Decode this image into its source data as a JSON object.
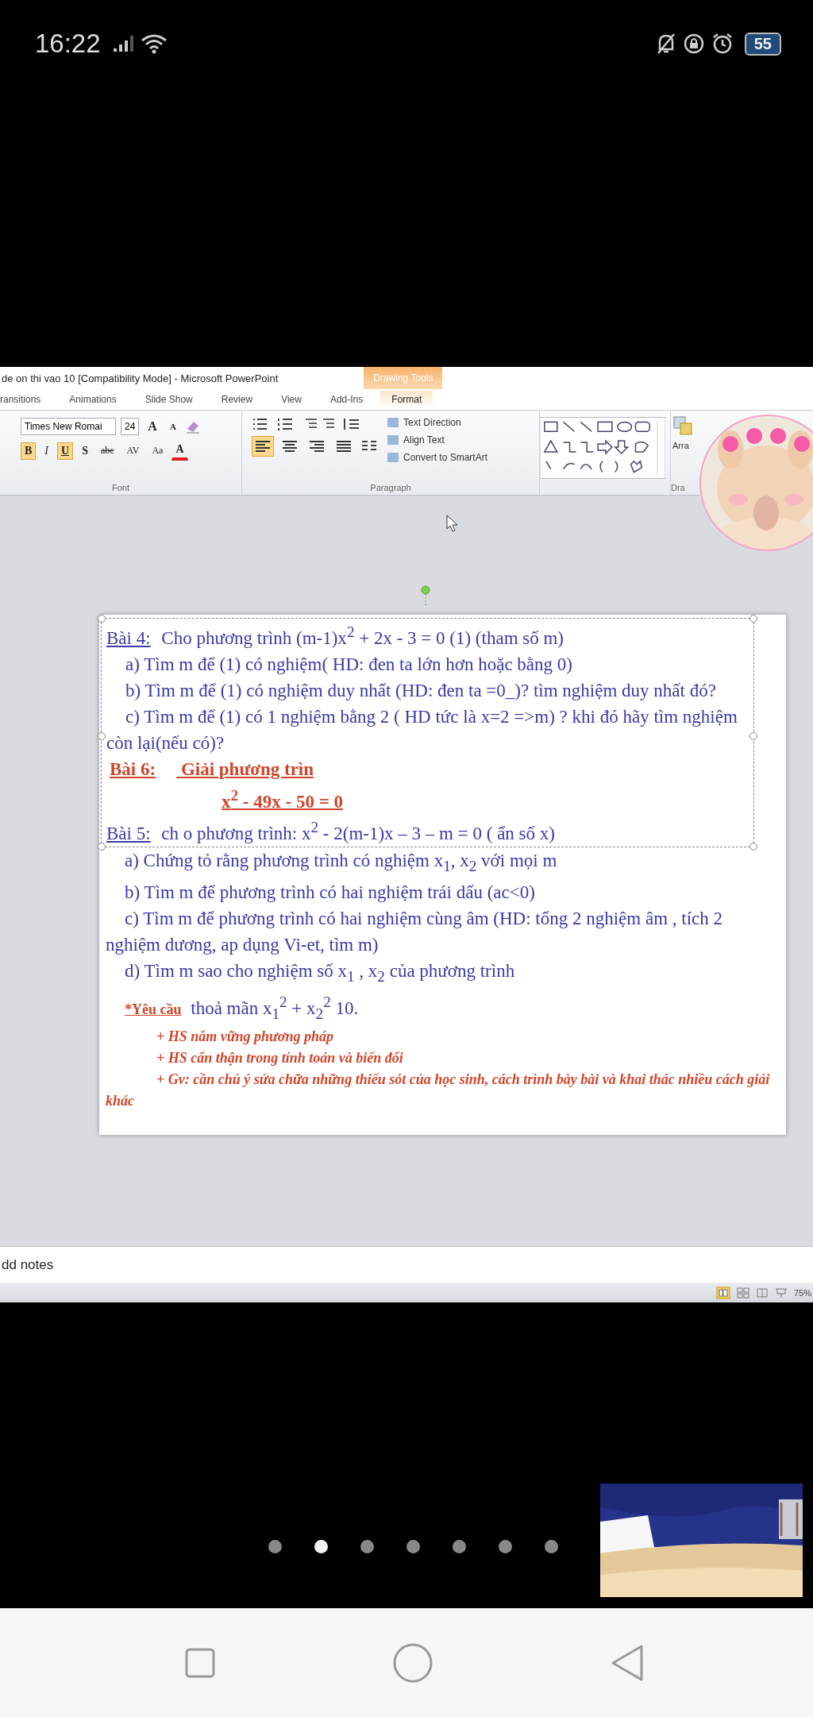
{
  "status_bar": {
    "time": "16:22",
    "battery": "55"
  },
  "powerpoint": {
    "title": "de on thi vao 10 [Compatibility Mode]  -  Microsoft PowerPoint",
    "context_tab_label": "Drawing Tools",
    "tabs": [
      {
        "label": "ransitions",
        "selected": false
      },
      {
        "label": "Animations",
        "selected": false
      },
      {
        "label": "Slide Show",
        "selected": false
      },
      {
        "label": "Review",
        "selected": false
      },
      {
        "label": "View",
        "selected": false
      },
      {
        "label": "Add-Ins",
        "selected": false
      },
      {
        "label": "Format",
        "selected": true
      }
    ],
    "ribbon": {
      "font_name": "Times New Romai",
      "font_size": "24",
      "grow_font": "A",
      "shrink_font": "A",
      "format_buttons": [
        {
          "label": "B",
          "kind": "bold",
          "selected": true
        },
        {
          "label": "I",
          "kind": "italic",
          "selected": false
        },
        {
          "label": "U",
          "kind": "underline",
          "selected": true
        },
        {
          "label": "S",
          "kind": "shadow",
          "selected": false
        },
        {
          "label": "abc",
          "kind": "strike",
          "selected": false
        },
        {
          "label": "AV",
          "kind": "spacing",
          "selected": false
        },
        {
          "label": "Aa",
          "kind": "case",
          "selected": false
        }
      ],
      "font_color": "A",
      "font_group": "Font",
      "align_buttons": [
        {
          "selected": true
        },
        {
          "selected": false
        },
        {
          "selected": false
        },
        {
          "selected": false
        }
      ],
      "paragraph_group": "Paragraph",
      "text_commands": [
        "Text Direction",
        "Align Text",
        "Convert to SmartArt"
      ],
      "arrange": "Arra",
      "drawing_group": "Dra"
    },
    "slide": {
      "text_boxes": [
        {
          "selected": true,
          "lines": [
            {
              "kind": "exercise",
              "label": "Bài 4:",
              "text": "Cho phương trình  (m-1)x$^{2}$ + 2x - 3 = 0   (1) (tham số m)"
            },
            {
              "kind": "item",
              "text": "a) Tìm m để (1) có  nghiệm( HD: đen ta  lớn hơn hoặc bằng 0)"
            },
            {
              "kind": "item",
              "text": "b) Tìm m để (1) có nghiệm duy nhất (HD: đen ta =0_)? tìm nghiệm duy nhất đó?"
            },
            {
              "kind": "item",
              "text": "c) Tìm m để (1) có 1 nghiệm bằng 2 ( HD tức là  x=2 =>m) ? khi đó hãy tìm nghiệm    còn lại(nếu có)?"
            },
            {
              "kind": "red-title",
              "label": "Bài 6:",
              "text": "Giải phương trìn"
            },
            {
              "kind": "red-equation",
              "text": "x$^{2}$ - 49x - 50 = 0"
            },
            {
              "kind": "exercise",
              "label": "Bài 5:",
              "text": "ch o phương trình:  x$^{2}$ - 2(m-1)x – 3 – m = 0 ( ẩn số x)"
            }
          ]
        },
        {
          "selected": false,
          "lines": [
            {
              "kind": "item",
              "text": "a) Chứng tỏ rằng phương trình có nghiệm x$_{1}$, x$_{2}$ với mọi m"
            },
            {
              "kind": "item",
              "text": "b) Tìm m để phương trình có hai nghiệm trái dấu (ac<0)"
            },
            {
              "kind": "item",
              "text": "c) Tìm m để phương trình có hai nghiệm cùng âm  (HD: tổng 2 nghiệm âm , tích 2 nghiệm dương, ap dụng Vi-et, tìm m)"
            },
            {
              "kind": "item",
              "text": "d) Tìm m sao cho nghiệm số x$_{1}$ , x$_{2}$ của phương trình"
            },
            {
              "kind": "requirement",
              "label": "*Yêu cầu",
              "text": "thoả mãn x$_{1}$$^{2}$  + x$_{2}$$^{2}$      10."
            },
            {
              "kind": "note",
              "text": "+ HS nắm vững phương pháp"
            },
            {
              "kind": "note",
              "text": "+ HS cẩn thận trong tính toán và biến đổi"
            },
            {
              "kind": "note",
              "text": "+ Gv: cần chú ý sửa chữa những thiếu sót của học sinh, cách trình bày bài và khai thác nhiều cách giải khác"
            }
          ]
        }
      ]
    },
    "notes_placeholder": "dd notes",
    "zoom": "75%"
  },
  "carousel": {
    "dots": [
      {
        "selected": false
      },
      {
        "selected": true
      },
      {
        "selected": false
      },
      {
        "selected": false
      },
      {
        "selected": false
      },
      {
        "selected": false
      },
      {
        "selected": false
      }
    ]
  }
}
